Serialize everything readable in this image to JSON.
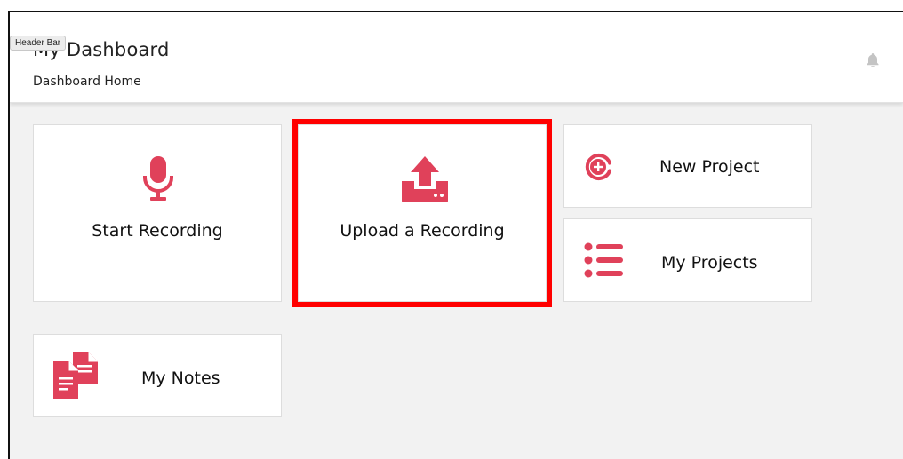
{
  "tooltip": {
    "label": "Header Bar"
  },
  "header": {
    "title": "My Dashboard",
    "breadcrumb": "Dashboard Home",
    "notification_icon": "bell-icon"
  },
  "tiles": {
    "start_recording": {
      "label": "Start Recording",
      "icon": "microphone-icon"
    },
    "upload_recording": {
      "label": "Upload a Recording",
      "icon": "upload-icon"
    },
    "new_project": {
      "label": "New Project",
      "icon": "plus-circle-icon"
    },
    "my_projects": {
      "label": "My Projects",
      "icon": "list-icon"
    },
    "my_notes": {
      "label": "My Notes",
      "icon": "documents-icon"
    }
  },
  "colors": {
    "accent": "#e0415a",
    "highlight": "#ff0000",
    "background": "#f2f2f2",
    "card": "#ffffff"
  }
}
